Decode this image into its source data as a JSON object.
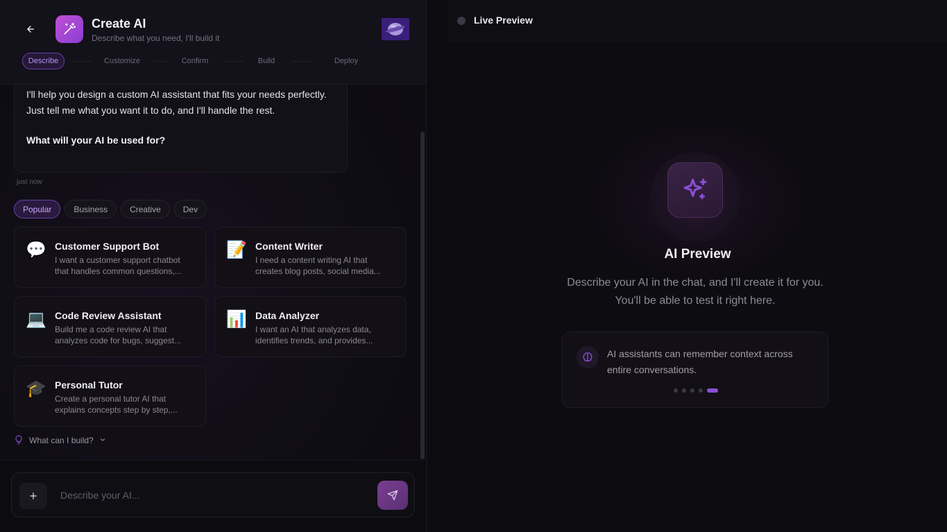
{
  "header": {
    "title": "Create AI",
    "subtitle": "Describe what you need, I'll build it"
  },
  "steps": [
    "Describe",
    "Customize",
    "Confirm",
    "Build",
    "Deploy"
  ],
  "message": {
    "text": "I'll help you design a custom AI assistant that fits your needs perfectly. Just tell me what you want it to do, and I'll handle the rest.",
    "question": "What will your AI be used for?",
    "timestamp": "just now"
  },
  "filters": [
    "Popular",
    "Business",
    "Creative",
    "Dev"
  ],
  "templates": [
    {
      "icon": "speech-bubble-icon",
      "emoji": "💬",
      "title": "Customer Support Bot",
      "desc": "I want a customer support chatbot that handles common questions,..."
    },
    {
      "icon": "memo-icon",
      "emoji": "📝",
      "title": "Content Writer",
      "desc": "I need a content writing AI that creates blog posts, social media..."
    },
    {
      "icon": "laptop-icon",
      "emoji": "💻",
      "title": "Code Review Assistant",
      "desc": "Build me a code review AI that analyzes code for bugs, suggest..."
    },
    {
      "icon": "bar-chart-icon",
      "emoji": "📊",
      "title": "Data Analyzer",
      "desc": "I want an AI that analyzes data, identifies trends, and provides..."
    },
    {
      "icon": "graduation-cap-icon",
      "emoji": "🎓",
      "title": "Personal Tutor",
      "desc": "Create a personal tutor AI that explains concepts step by step,..."
    }
  ],
  "help": {
    "label": "What can I build?"
  },
  "composer": {
    "placeholder": "Describe your AI..."
  },
  "preview": {
    "header": "Live Preview",
    "title": "AI Preview",
    "desc": "Describe your AI in the chat, and I'll create it for you. You'll be able to test it right here.",
    "tip": "AI assistants can remember context across entire conversations."
  },
  "colors": {
    "accent": "#8a4fd6",
    "background": "#0c0b10"
  }
}
